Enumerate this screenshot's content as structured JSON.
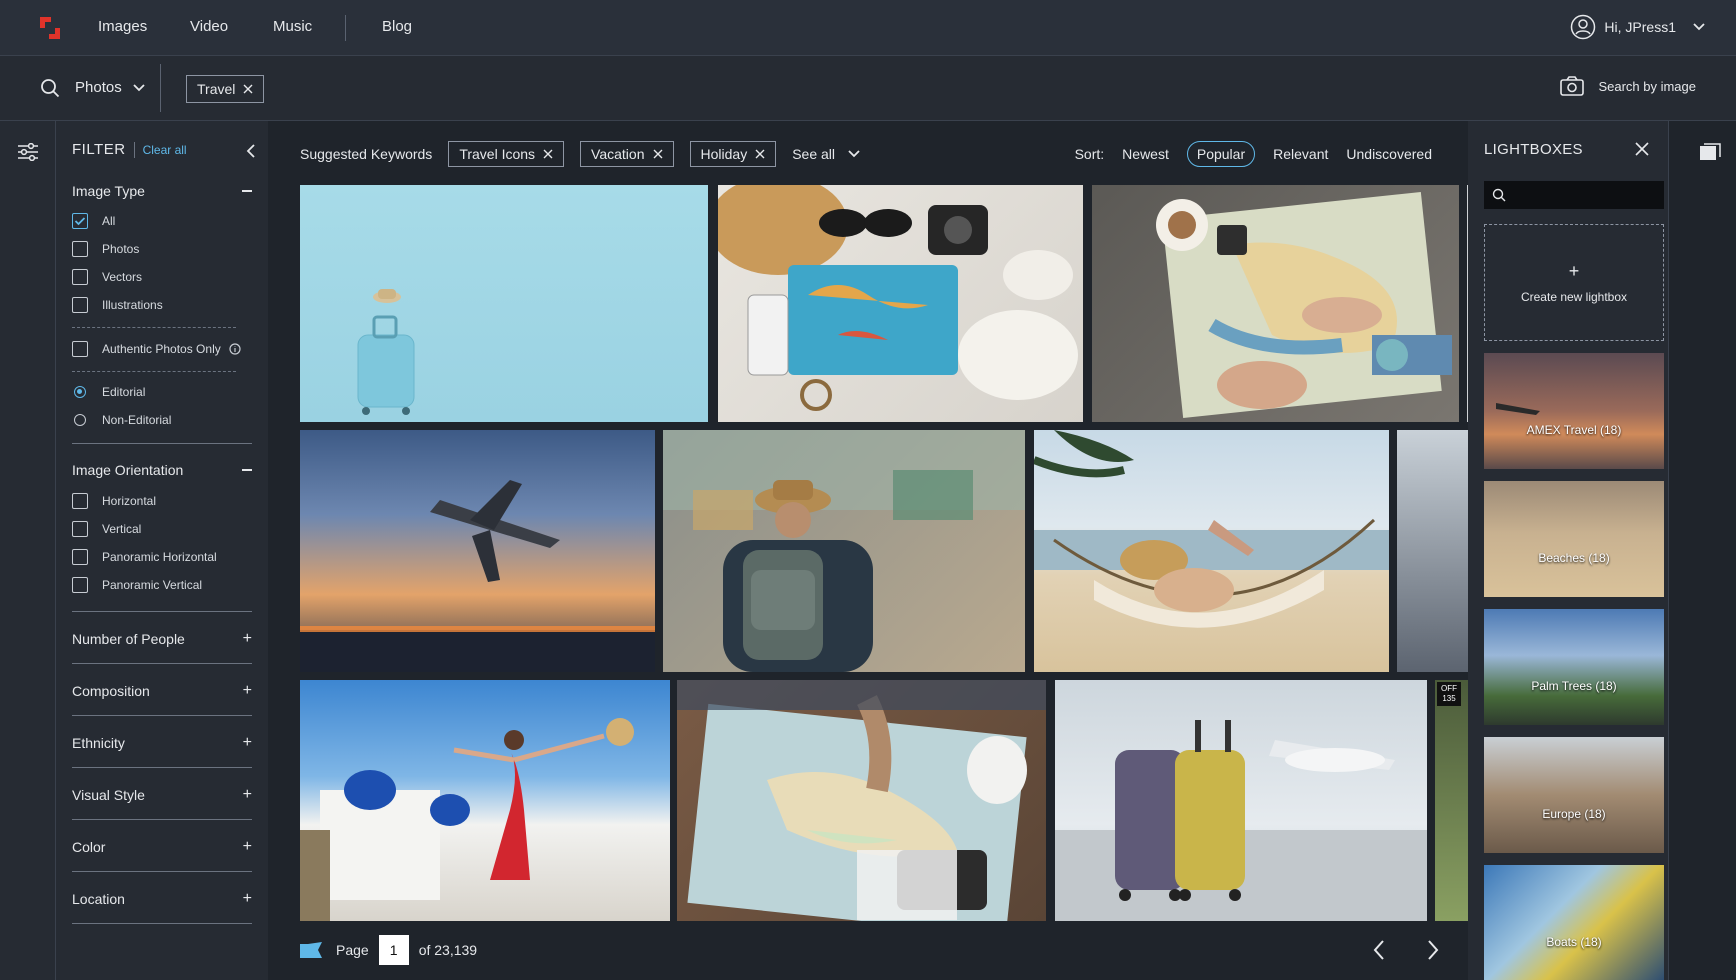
{
  "nav": {
    "images": "Images",
    "video": "Video",
    "music": "Music",
    "blog": "Blog",
    "user": "Hi, JPress1"
  },
  "search": {
    "type": "Photos",
    "chip": "Travel",
    "by_image": "Search by image"
  },
  "filter": {
    "title": "FILTER",
    "clear_all": "Clear all",
    "image_type": {
      "title": "Image Type",
      "options": [
        "All",
        "Photos",
        "Vectors",
        "Illustrations"
      ],
      "authentic": "Authentic Photos Only",
      "editorial": "Editorial",
      "non_editorial": "Non-Editorial"
    },
    "orientation": {
      "title": "Image Orientation",
      "options": [
        "Horizontal",
        "Vertical",
        "Panoramic Horizontal",
        "Panoramic Vertical"
      ]
    },
    "collapsed": [
      "Number of People",
      "Composition",
      "Ethnicity",
      "Visual Style",
      "Color",
      "Location"
    ]
  },
  "keywords": {
    "label": "Suggested Keywords",
    "chips": [
      "Travel Icons",
      "Vacation",
      "Holiday"
    ],
    "see_all": "See all"
  },
  "sort": {
    "label": "Sort:",
    "options": [
      "Newest",
      "Popular",
      "Relevant",
      "Undiscovered"
    ],
    "selected": "Popular"
  },
  "pager": {
    "label": "Page",
    "current": "1",
    "of": "of 23,139"
  },
  "lightboxes": {
    "title": "LIGHTBOXES",
    "create": "Create new lightbox",
    "items": [
      "AMEX Travel (18)",
      "Beaches (18)",
      "Palm Trees (18)",
      "Europe (18)",
      "Boats (18)"
    ]
  },
  "colors": {
    "accent": "#5fb8e8",
    "brand": "#e0332a"
  }
}
